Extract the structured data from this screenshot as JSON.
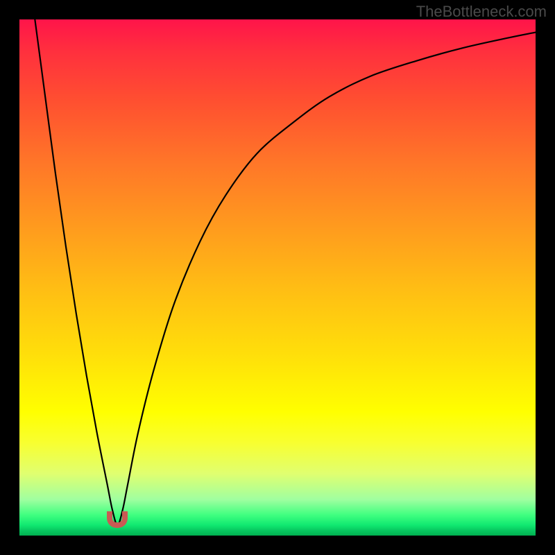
{
  "watermark": "TheBottleneck.com",
  "chart_data": {
    "type": "line",
    "title": "",
    "xlabel": "",
    "ylabel": "",
    "xlim": [
      0,
      100
    ],
    "ylim": [
      0,
      100
    ],
    "description": "Bottleneck profile curve over a red-to-green vertical gradient. Y-axis color: red (top) = high bottleneck, green (bottom) = optimal. A single black curve descends steeply from the top-left, reaches a narrow minimum near x≈19 at the very bottom, then rises asymptotically toward the upper right. A small U-shaped red-brown marker sits at the minimum.",
    "gradient_stops": [
      {
        "pct": 0,
        "color": "#ff144a"
      },
      {
        "pct": 6,
        "color": "#ff2f3e"
      },
      {
        "pct": 16,
        "color": "#ff5030"
      },
      {
        "pct": 28,
        "color": "#ff7728"
      },
      {
        "pct": 40,
        "color": "#ff9a1e"
      },
      {
        "pct": 52,
        "color": "#ffbd14"
      },
      {
        "pct": 65,
        "color": "#ffdf0a"
      },
      {
        "pct": 76,
        "color": "#ffff00"
      },
      {
        "pct": 82,
        "color": "#f8ff30"
      },
      {
        "pct": 88,
        "color": "#e0ff70"
      },
      {
        "pct": 93,
        "color": "#a0ffa0"
      },
      {
        "pct": 96,
        "color": "#40ff80"
      },
      {
        "pct": 98,
        "color": "#10e870"
      },
      {
        "pct": 99,
        "color": "#08c860"
      },
      {
        "pct": 100,
        "color": "#00b050"
      }
    ],
    "series": [
      {
        "name": "bottleneck-curve",
        "x": [
          3,
          5,
          7,
          9,
          11,
          13,
          15,
          17,
          18,
          19,
          20,
          21,
          23,
          26,
          30,
          35,
          40,
          46,
          53,
          60,
          68,
          77,
          86,
          95,
          100
        ],
        "y": [
          100,
          85,
          70,
          56,
          43,
          31,
          20,
          10,
          5,
          2,
          5,
          10,
          20,
          32,
          45,
          57,
          66,
          74,
          80,
          85,
          89,
          92,
          94.5,
          96.5,
          97.5
        ]
      }
    ],
    "minimum_marker": {
      "x": 19,
      "y": 2,
      "color": "#c85a54"
    }
  }
}
